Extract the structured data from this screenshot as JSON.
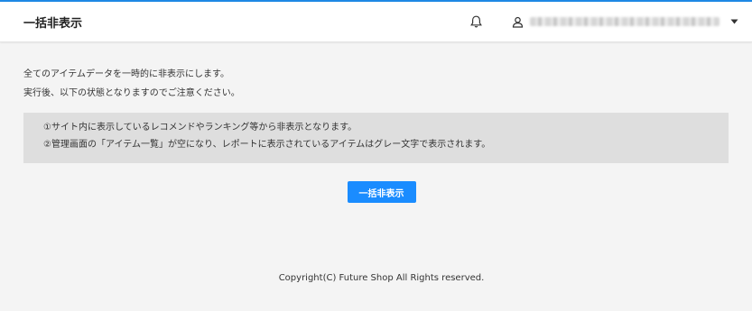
{
  "header": {
    "title": "一括非表示",
    "bell_icon": "bell-icon",
    "user_icon": "user-icon",
    "dropdown_icon": "caret-down-icon"
  },
  "main": {
    "intro_lines": [
      "全てのアイテムデータを一時的に非表示にします。",
      "実行後、以下の状態となりますのでご注意ください。"
    ],
    "notice_lines": [
      "①サイト内に表示しているレコメンドやランキング等から非表示となります。",
      "②管理画面の「アイテム一覧」が空になり、レポートに表示されているアイテムはグレー文字で表示されます。"
    ],
    "button_label": "一括非表示"
  },
  "footer": {
    "copyright": "Copyright(C) Future Shop All Rights reserved."
  },
  "colors": {
    "accent": "#1a8cff",
    "topline": "#1e88e5",
    "notice_bg": "#dedede",
    "page_bg": "#f4f4f4"
  }
}
